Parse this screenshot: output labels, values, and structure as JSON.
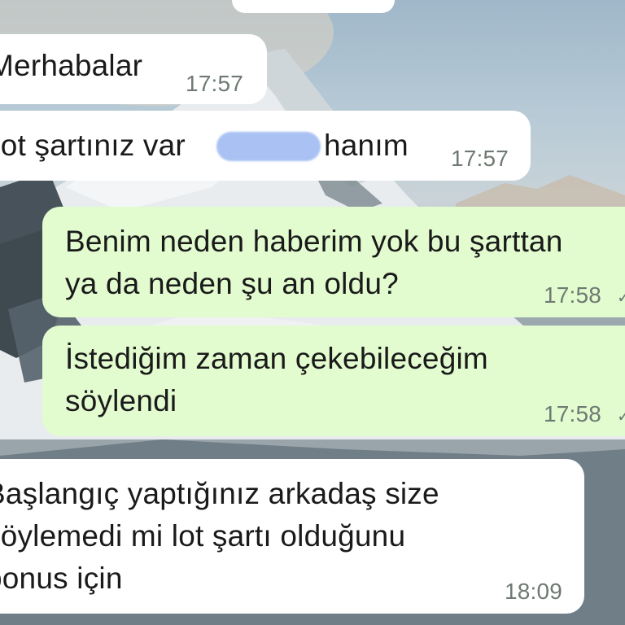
{
  "messages": [
    {
      "direction": "incoming",
      "text": "Merhabalar",
      "time": "17:57"
    },
    {
      "direction": "incoming",
      "text": "Lot şartınız var",
      "text_after_redaction": "hanım",
      "time": "17:57"
    },
    {
      "direction": "outgoing",
      "lines": [
        "Benim neden haberim yok bu şarttan",
        "ya da neden şu an oldu?"
      ],
      "time": "17:58",
      "status_icon": "check-icon"
    },
    {
      "direction": "outgoing",
      "lines": [
        "İstediğim zaman çekebileceğim",
        "söylendi"
      ],
      "time": "17:58",
      "status_icon": "check-icon"
    },
    {
      "direction": "incoming",
      "lines": [
        "Başlangıç yaptığınız arkadaş size",
        "söylemedi mi lot şartı olduğunu",
        "bonus için"
      ],
      "time": "18:09"
    }
  ],
  "colors": {
    "incoming_bubble": "#ffffff",
    "outgoing_bubble": "#e2fbcf",
    "timestamp": "#6f7a72",
    "redaction": "#a9c2f3"
  }
}
